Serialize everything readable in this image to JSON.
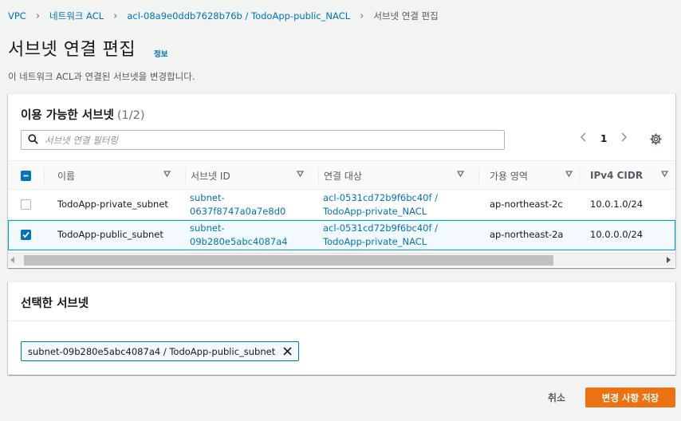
{
  "breadcrumb": [
    "VPC",
    "네트워크 ACL",
    "acl-08a9e0ddb7628b76b / TodoApp-public_NACL",
    "서브넷 연결 편집"
  ],
  "page": {
    "title": "서브넷 연결 편집",
    "info_label": "정보",
    "description": "이 네트워크 ACL과 연결된 서브넷을 변경합니다."
  },
  "available": {
    "title": "이용 가능한 서브넷",
    "count": "(1/2)",
    "filter_placeholder": "서브넷 연결 필터링",
    "filter_value": "",
    "page_number": "1",
    "columns": [
      "이름",
      "서브넷 ID",
      "연결 대상",
      "가용 영역",
      "IPv4 CIDR"
    ],
    "rows": [
      {
        "checked": false,
        "name": "TodoApp-private_subnet",
        "subnet_id_1": "subnet-",
        "subnet_id_2": "0637f8747a0a7e8d0",
        "assoc_1": "acl-0531cd72b9f6bc40f /",
        "assoc_2": "TodoApp-private_NACL",
        "az": "ap-northeast-2c",
        "cidr": "10.0.1.0/24"
      },
      {
        "checked": true,
        "name": "TodoApp-public_subnet",
        "subnet_id_1": "subnet-",
        "subnet_id_2": "09b280e5abc4087a4",
        "assoc_1": "acl-0531cd72b9f6bc40f /",
        "assoc_2": "TodoApp-private_NACL",
        "az": "ap-northeast-2a",
        "cidr": "10.0.0.0/24"
      }
    ]
  },
  "selected": {
    "title": "선택한 서브넷",
    "tokens": [
      "subnet-09b280e5abc4087a4 / TodoApp-public_subnet"
    ]
  },
  "actions": {
    "cancel": "취소",
    "save": "변경 사항 저장"
  },
  "colors": {
    "link": "#0073bb",
    "primary_button": "#ec7211",
    "selected_row_border": "#00a1c9",
    "checkbox_checked": "#0073bb"
  }
}
